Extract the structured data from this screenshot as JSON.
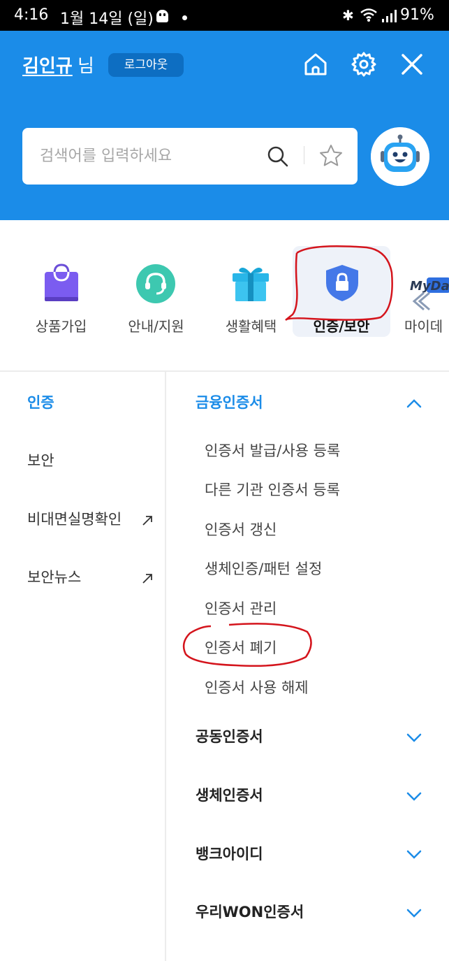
{
  "status_bar": {
    "time": "4:16",
    "date": "1월 14일 (일)",
    "battery": "91%"
  },
  "header": {
    "user_name": "김인규",
    "user_suffix": "님",
    "logout_label": "로그아웃",
    "search_placeholder": "검색어를 입력하세요",
    "bg_color": "#1b8ce8"
  },
  "categories": [
    {
      "label": "상품가입",
      "icon": "shopping-bag-icon"
    },
    {
      "label": "안내/지원",
      "icon": "headset-icon"
    },
    {
      "label": "생활혜택",
      "icon": "gift-icon"
    },
    {
      "label": "인증/보안",
      "icon": "shield-lock-icon",
      "active": true
    },
    {
      "label": "마이데",
      "icon": "mydata-icon",
      "badge": "MyDa"
    }
  ],
  "left_menu": [
    {
      "label": "인증",
      "active": true
    },
    {
      "label": "보안"
    },
    {
      "label": "비대면실명확인",
      "external": true
    },
    {
      "label": "보안뉴스",
      "external": true
    }
  ],
  "sections": [
    {
      "title": "금융인증서",
      "expanded": true,
      "items": [
        "인증서 발급/사용 등록",
        "다른 기관 인증서 등록",
        "인증서 갱신",
        "생체인증/패턴 설정",
        "인증서 관리",
        "인증서 폐기",
        "인증서 사용 해제"
      ]
    },
    {
      "title": "공동인증서",
      "expanded": false
    },
    {
      "title": "생체인증서",
      "expanded": false
    },
    {
      "title": "뱅크아이디",
      "expanded": false
    },
    {
      "title": "우리WON인증서",
      "expanded": false
    }
  ],
  "colors": {
    "accent": "#1b8ce8",
    "annotation": "#d4141c"
  }
}
